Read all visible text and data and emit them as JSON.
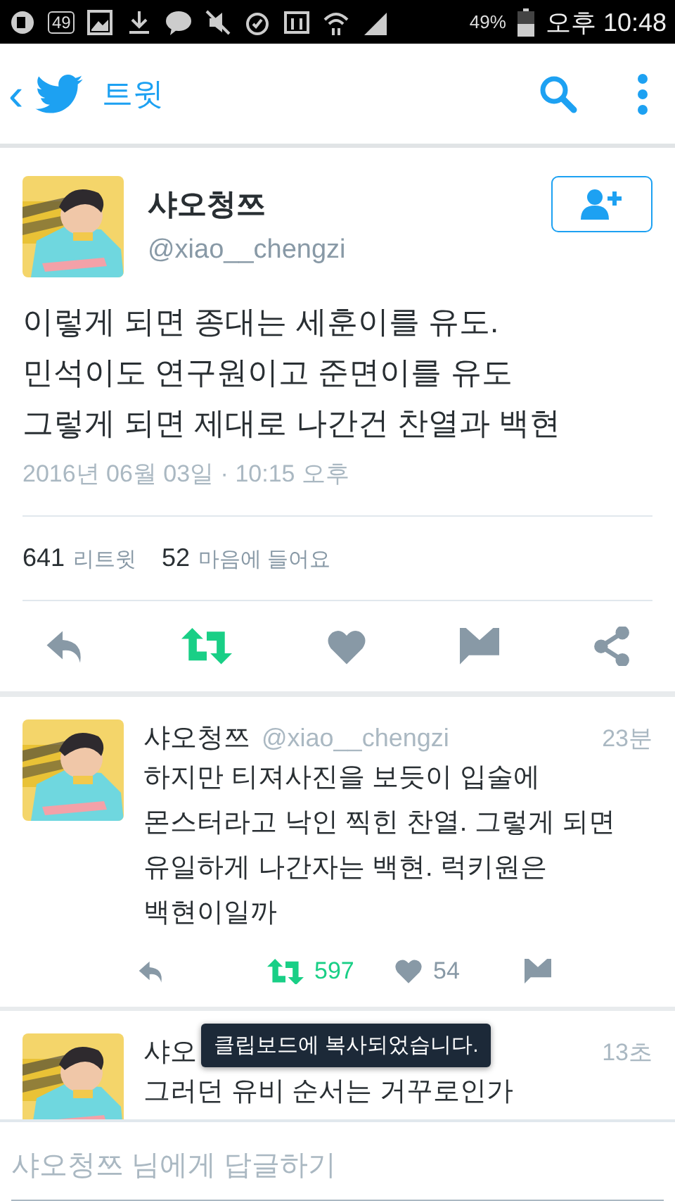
{
  "status_bar": {
    "notification_badge": "49",
    "battery": "49%",
    "time": "오후 10:48"
  },
  "app_bar": {
    "back": "‹",
    "title": "트윗"
  },
  "tweet": {
    "name": "샤오청쯔",
    "handle": "@xiao__chengzi",
    "text": "이렇게 되면 종대는 세훈이를 유도.\n민석이도 연구원이고 준면이를 유도\n그렇게 되면 제대로 나간건 찬열과 백현",
    "timestamp": "2016년 06월 03일 · 10:15 오후",
    "stats": [
      {
        "count": "641",
        "label": "리트윗"
      },
      {
        "count": "52",
        "label": "마음에 들어요"
      }
    ],
    "retweeted": true,
    "liked": false
  },
  "replies": [
    {
      "name": "샤오청쯔",
      "handle": "@xiao__chengzi",
      "time": "23분",
      "text": "하지만 티져사진을 보듯이 입술에\n몬스터라고 낙인 찍힌 찬열. 그렇게 되면\n유일하게 나간자는 백현. 럭키원은\n백현이일까",
      "retweeted": true,
      "retweet_count": "597",
      "liked": false,
      "like_count": "54"
    },
    {
      "name": "샤오",
      "time": "13초",
      "text": "그러던 유비 순서는 거꾸로인가"
    }
  ],
  "toast": "클립보드에 복사되었습니다.",
  "reply_field": {
    "placeholder": "샤오청쯔 님에게 답글하기"
  }
}
